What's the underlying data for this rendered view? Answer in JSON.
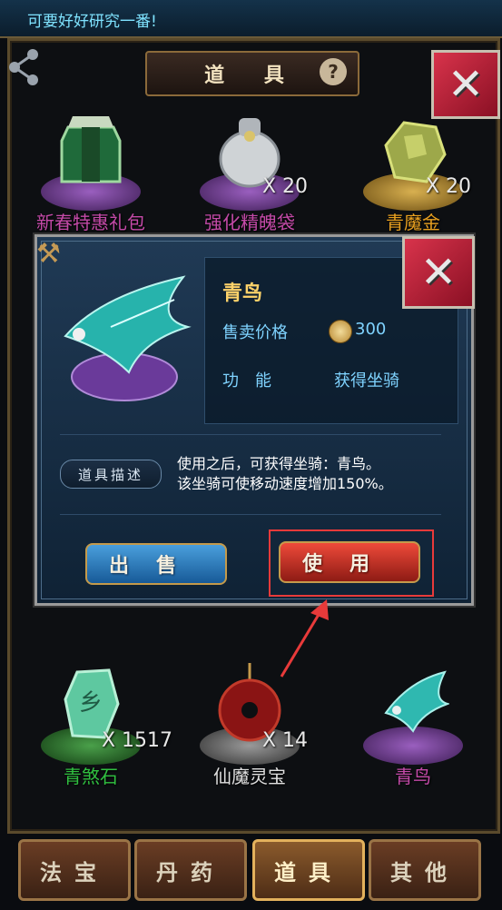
{
  "header": {
    "tip": "可要好好研究一番!"
  },
  "panel": {
    "title": "道 具"
  },
  "items_top": [
    {
      "name": "新春特惠礼包",
      "count": "",
      "name_color": "#c44aa8",
      "disc_color": "#7a3f9a"
    },
    {
      "name": "强化精魄袋",
      "count": "X 20",
      "name_color": "#c44aa8",
      "disc_color": "#7a3f9a"
    },
    {
      "name": "青魔金",
      "count": "X 20",
      "name_color": "#e8a020",
      "disc_color": "#b58a2a"
    }
  ],
  "items_bottom": [
    {
      "name": "青煞石",
      "count": "X 1517",
      "name_color": "#30c040",
      "disc_color": "#2a7a2a"
    },
    {
      "name": "仙魔灵宝",
      "count": "X 14",
      "name_color": "#e0e0e0",
      "disc_color": "#7a7a7a"
    },
    {
      "name": "青鸟",
      "count": "",
      "name_color": "#c44aa8",
      "disc_color": "#7a3f9a"
    }
  ],
  "detail": {
    "name": "青鸟",
    "price_label": "售卖价格",
    "price": "300",
    "function_label": "功　能",
    "function_value": "获得坐骑",
    "desc_tag": "道具描述",
    "desc_line1": "使用之后，可获得坐骑：青鸟。",
    "desc_line2": "该坐骑可使移动速度增加150%。",
    "sell_label": "出售",
    "use_label": "使用"
  },
  "tabs": [
    {
      "label": "法宝",
      "active": false
    },
    {
      "label": "丹药",
      "active": false
    },
    {
      "label": "道具",
      "active": true
    },
    {
      "label": "其他",
      "active": false
    }
  ]
}
